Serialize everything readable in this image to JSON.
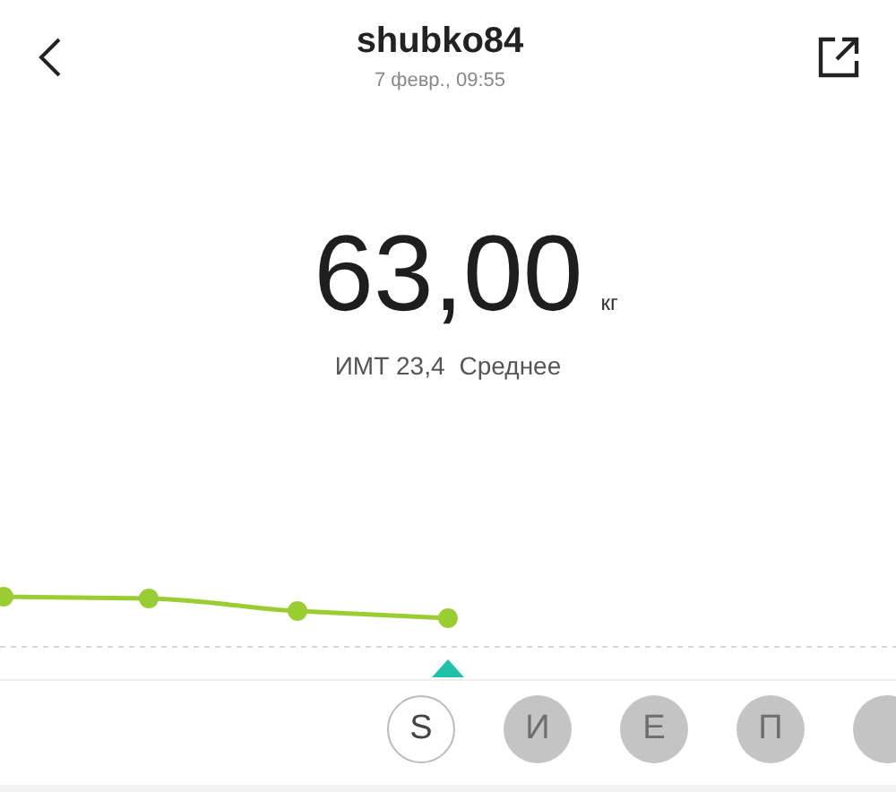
{
  "header": {
    "title": "shubko84",
    "subtitle": "7 февр., 09:55"
  },
  "measurement": {
    "value": "63,00",
    "unit": "кг",
    "bmi_label": "ИМТ 23,4",
    "bmi_category": "Среднее"
  },
  "users": [
    {
      "initial": "S",
      "selected": true
    },
    {
      "initial": "И",
      "selected": false
    },
    {
      "initial": "Е",
      "selected": false
    },
    {
      "initial": "П",
      "selected": false
    },
    {
      "selected": false
    }
  ]
}
